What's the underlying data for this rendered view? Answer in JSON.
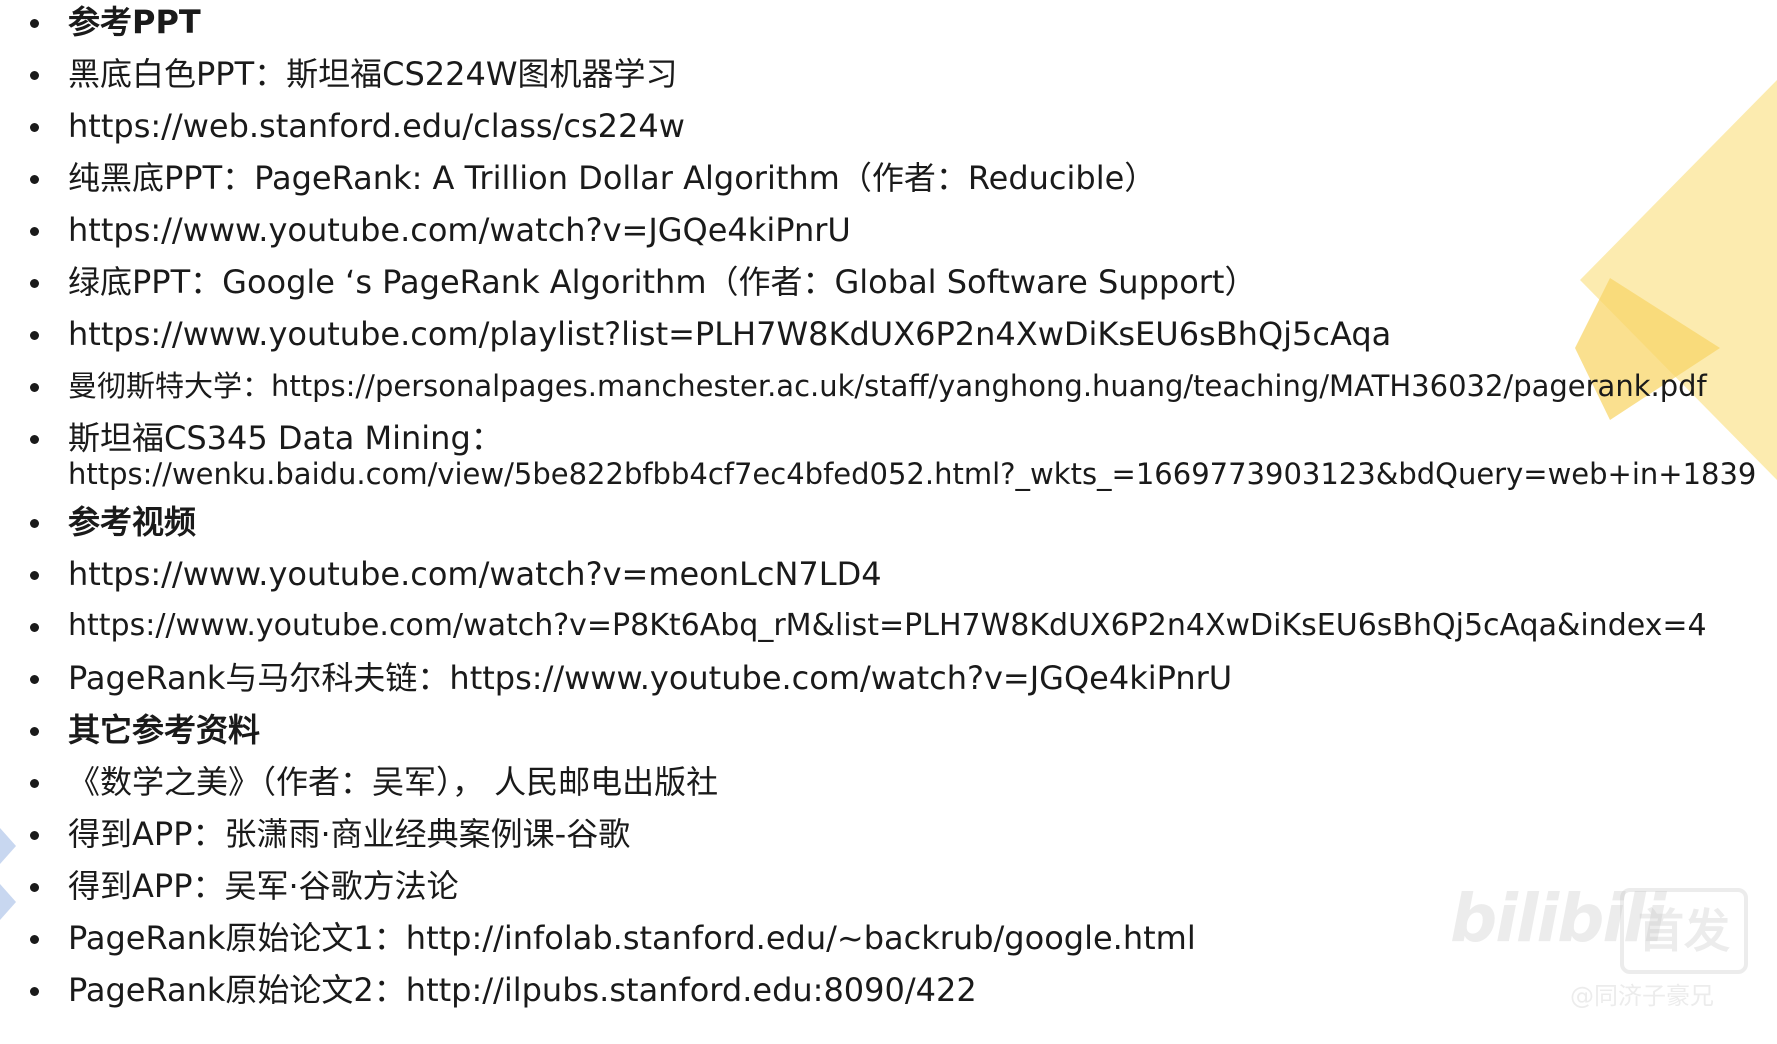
{
  "colors": {
    "text": "#1a1a1a",
    "accent_yellow": "#fbe7a1",
    "accent_yellow_dark": "#f8d56a",
    "accent_blue": "#c8d7f0"
  },
  "items": [
    {
      "text": "参考PPT",
      "heading": true
    },
    {
      "text": "黑底白色PPT：斯坦福CS224W图机器学习",
      "heading": false
    },
    {
      "text": "https://web.stanford.edu/class/cs224w",
      "heading": false
    },
    {
      "text": "纯黑底PPT：PageRank: A Trillion Dollar Algorithm（作者：Reducible）",
      "heading": false
    },
    {
      "text": "https://www.youtube.com/watch?v=JGQe4kiPnrU",
      "heading": false
    },
    {
      "text": "绿底PPT：Google ‘s PageRank Algorithm（作者：Global Software Support）",
      "heading": false
    },
    {
      "text": "https://www.youtube.com/playlist?list=PLH7W8KdUX6P2n4XwDiKsEU6sBhQj5cAqa",
      "heading": false
    },
    {
      "text": "曼彻斯特大学：https://personalpages.manchester.ac.uk/staff/yanghong.huang/teaching/MATH36032/pagerank.pdf",
      "heading": false
    },
    {
      "text": "斯坦福CS345 Data Mining：",
      "text2": "https://wenku.baidu.com/view/5be822bfbb4cf7ec4bfed052.html?_wkts_=1669773903123&bdQuery=web+in+1839",
      "heading": false
    },
    {
      "text": "参考视频",
      "heading": true
    },
    {
      "text": "https://www.youtube.com/watch?v=meonLcN7LD4",
      "heading": false
    },
    {
      "text": "https://www.youtube.com/watch?v=P8Kt6Abq_rM&list=PLH7W8KdUX6P2n4XwDiKsEU6sBhQj5cAqa&index=4",
      "heading": false
    },
    {
      "text": "PageRank与马尔科夫链：https://www.youtube.com/watch?v=JGQe4kiPnrU",
      "heading": false
    },
    {
      "text": "其它参考资料",
      "heading": true
    },
    {
      "text": "《数学之美》（作者：吴军）， 人民邮电出版社",
      "heading": false
    },
    {
      "text": "得到APP：张潇雨·商业经典案例课-谷歌",
      "heading": false
    },
    {
      "text": "得到APP：吴军·谷歌方法论",
      "heading": false
    },
    {
      "text": "PageRank原始论文1：http://infolab.stanford.edu/~backrub/google.html",
      "heading": false
    },
    {
      "text": "PageRank原始论文2：http://ilpubs.stanford.edu:8090/422",
      "heading": false
    }
  ],
  "watermark": {
    "logo": "bilibili",
    "badge": "首发",
    "sub": "@同济子豪兄"
  }
}
